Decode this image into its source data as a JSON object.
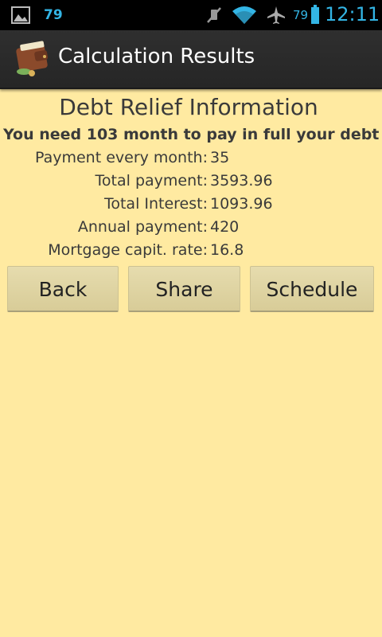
{
  "status_bar": {
    "notification_count": "79",
    "battery_level": "79",
    "time": "12:11",
    "icons": [
      "gallery-icon",
      "mute-icon",
      "wifi-icon",
      "airplane-icon",
      "battery-icon"
    ]
  },
  "action_bar": {
    "title": "Calculation Results",
    "icon": "wallet-icon"
  },
  "content": {
    "heading": "Debt Relief Information",
    "summary": "You need 103 month to pay in full your debt",
    "rows": [
      {
        "label": "Payment every month:",
        "value": "35"
      },
      {
        "label": "Total payment:",
        "value": "3593.96"
      },
      {
        "label": "Total Interest:",
        "value": "1093.96"
      },
      {
        "label": "Annual payment:",
        "value": "420"
      },
      {
        "label": "Mortgage capit. rate:",
        "value": "16.8"
      }
    ]
  },
  "buttons": {
    "back": "Back",
    "share": "Share",
    "schedule": "Schedule"
  },
  "colors": {
    "background": "#ffeaa1",
    "status_accent": "#33b5e5",
    "button": "#e0d6a6"
  }
}
